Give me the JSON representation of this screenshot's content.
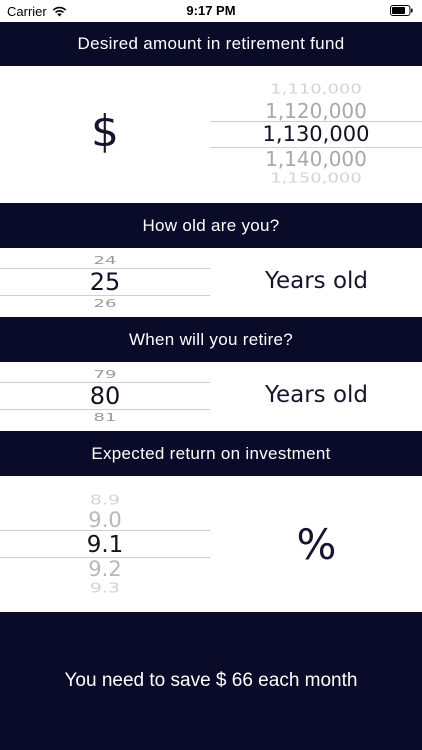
{
  "status_bar": {
    "carrier": "Carrier",
    "time": "9:17 PM"
  },
  "sections": {
    "fund": {
      "header": "Desired amount in retirement fund",
      "currency_symbol": "$",
      "picker": {
        "above_2": "1,110,000",
        "above_1": "1,120,000",
        "selected": "1,130,000",
        "below_1": "1,140,000",
        "below_2": "1,150,000"
      }
    },
    "age": {
      "header": "How old are you?",
      "unit": "Years old",
      "picker": {
        "above_1": "24",
        "selected": "25",
        "below_1": "26"
      }
    },
    "retire": {
      "header": "When will you retire?",
      "unit": "Years old",
      "picker": {
        "above_1": "79",
        "selected": "80",
        "below_1": "81"
      }
    },
    "return": {
      "header": "Expected return on investment",
      "unit": "%",
      "picker": {
        "above_2": "8.9",
        "above_1": "9.0",
        "selected": "9.1",
        "below_1": "9.2",
        "below_2": "9.3"
      }
    }
  },
  "result": {
    "text": "You need to save $ 66 each month"
  },
  "colors": {
    "band": "#0a0a29",
    "text_dark": "#111122"
  }
}
